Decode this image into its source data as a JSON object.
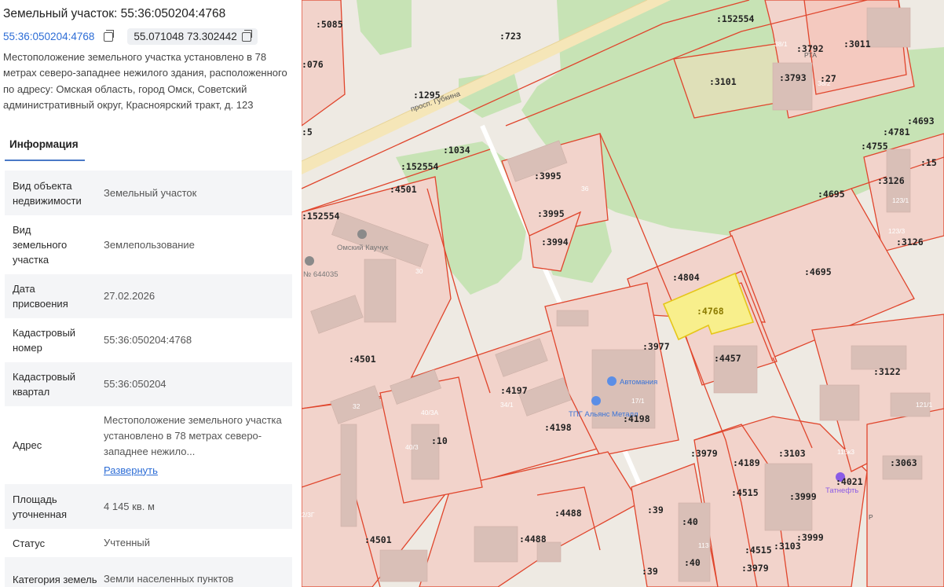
{
  "panel": {
    "title": "Земельный участок: 55:36:050204:4768",
    "cad_link": "55:36:050204:4768",
    "coords": "55.071048 73.302442",
    "description": "Местоположение земельного участка установлено в 78 метрах северо-западнее нежилого здания, расположенного по адресу: Омская область, город Омск, Советский административный округ, Красноярский тракт, д. 123",
    "tab": "Информация",
    "rows": [
      {
        "label": "Вид объекта недвижимости",
        "value": "Земельный участок"
      },
      {
        "label": "Вид земельного участка",
        "value": "Землепользование"
      },
      {
        "label": "Дата присвоения",
        "value": "27.02.2026"
      },
      {
        "label": "Кадастровый номер",
        "value": "55:36:050204:4768"
      },
      {
        "label": "Кадастровый квартал",
        "value": "55:36:050204"
      },
      {
        "label": "Адрес",
        "value": "Местоположение земельного участка установлено в 78 метрах северо-западнее нежило...",
        "link": "Развернуть"
      },
      {
        "label": "Площадь уточненная",
        "value": "4 145 кв. м"
      },
      {
        "label": "Статус",
        "value": "Учтенный"
      },
      {
        "label": "Категория земель",
        "value": "Земли населенных пунктов"
      }
    ]
  },
  "map": {
    "parcel_labels": [
      ":5085",
      ":723",
      ":152554",
      ":076",
      ":1295",
      ":3101",
      ":3792",
      ":3011",
      ":3793",
      ":27",
      ":4693",
      ":4781",
      ":4755",
      ":15",
      ":1034",
      ":152554",
      ":4501",
      ":3995",
      ":3995",
      ":3126",
      ":4695",
      ":152554",
      ":3994",
      ":3126",
      ":4804",
      ":4695",
      ":4768",
      ":3977",
      ":4501",
      ":4457",
      ":3122",
      ":4197",
      ":4198",
      ":4198",
      ":10",
      ":3979",
      ":4189",
      ":3103",
      ":3063",
      ":4021",
      ":4515",
      ":3999",
      ":39",
      ":4488",
      ":40",
      ":4488",
      ":4501",
      ":3999",
      ":4515",
      ":3103",
      ":40",
      ":39",
      ":3979",
      ":5"
    ],
    "street": "просп. Губкина",
    "pois": [
      "Омский Каучук",
      "№ 644035",
      "Автомания",
      "ТПГ Альянс Металл",
      "Татнефть"
    ],
    "house_numbers": [
      "30",
      "17/1",
      "34/1",
      "40/3А",
      "40/3",
      "32",
      "2/3Г",
      "113",
      "115к3",
      "121/1",
      "123/1",
      "123/3",
      "38/1",
      "38/2",
      "36",
      "Р",
      "РТА"
    ],
    "colors": {
      "parcel_border": "#e0452c",
      "parcel_fill": "#f2d3cb",
      "park": "#c7e3b5",
      "selected_fill": "#f8ef8c",
      "selected_border": "#e6c619"
    }
  }
}
